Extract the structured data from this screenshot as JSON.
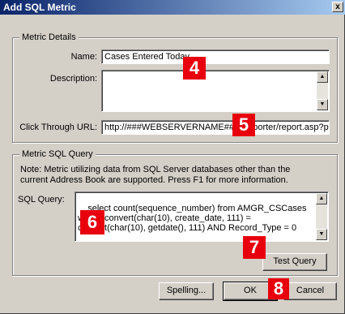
{
  "dialog": {
    "title": "Add SQL Metric",
    "close_glyph": "x"
  },
  "metric_details": {
    "legend": "Metric Details",
    "name_label": "Name:",
    "name_value": "Cases Entered Today",
    "description_label": "Description:",
    "description_value": "",
    "click_through_label": "Click Through URL:",
    "click_through_value": "http://###WEBSERVERNAME###/Reporter/report.asp?p"
  },
  "metric_sql_query": {
    "legend": "Metric SQL Query",
    "note": "Note: Metric utilizing data from SQL Server databases other than the\ncurrent Address Book are supported. Press F1 for more information.",
    "sql_label": "SQL Query:",
    "sql_value": "select count(sequence_number) from AMGR_CSCases\nwhere convert(char(10), create_date, 111) =\nconvert(char(10), getdate(), 111) AND Record_Type = 0",
    "test_query_label": "Test Query"
  },
  "buttons": {
    "spelling_label": "Spelling...",
    "ok_label": "OK",
    "cancel_label": "Cancel"
  },
  "callouts": [
    "4",
    "5",
    "6",
    "7",
    "8"
  ],
  "icons": {
    "scroll_up": "scroll-up-arrow-icon",
    "scroll_down": "scroll-down-arrow-icon"
  },
  "colors": {
    "title_bar": "#0a246a",
    "dialog_face": "#d4d0c8",
    "callout": "#e8000d"
  }
}
